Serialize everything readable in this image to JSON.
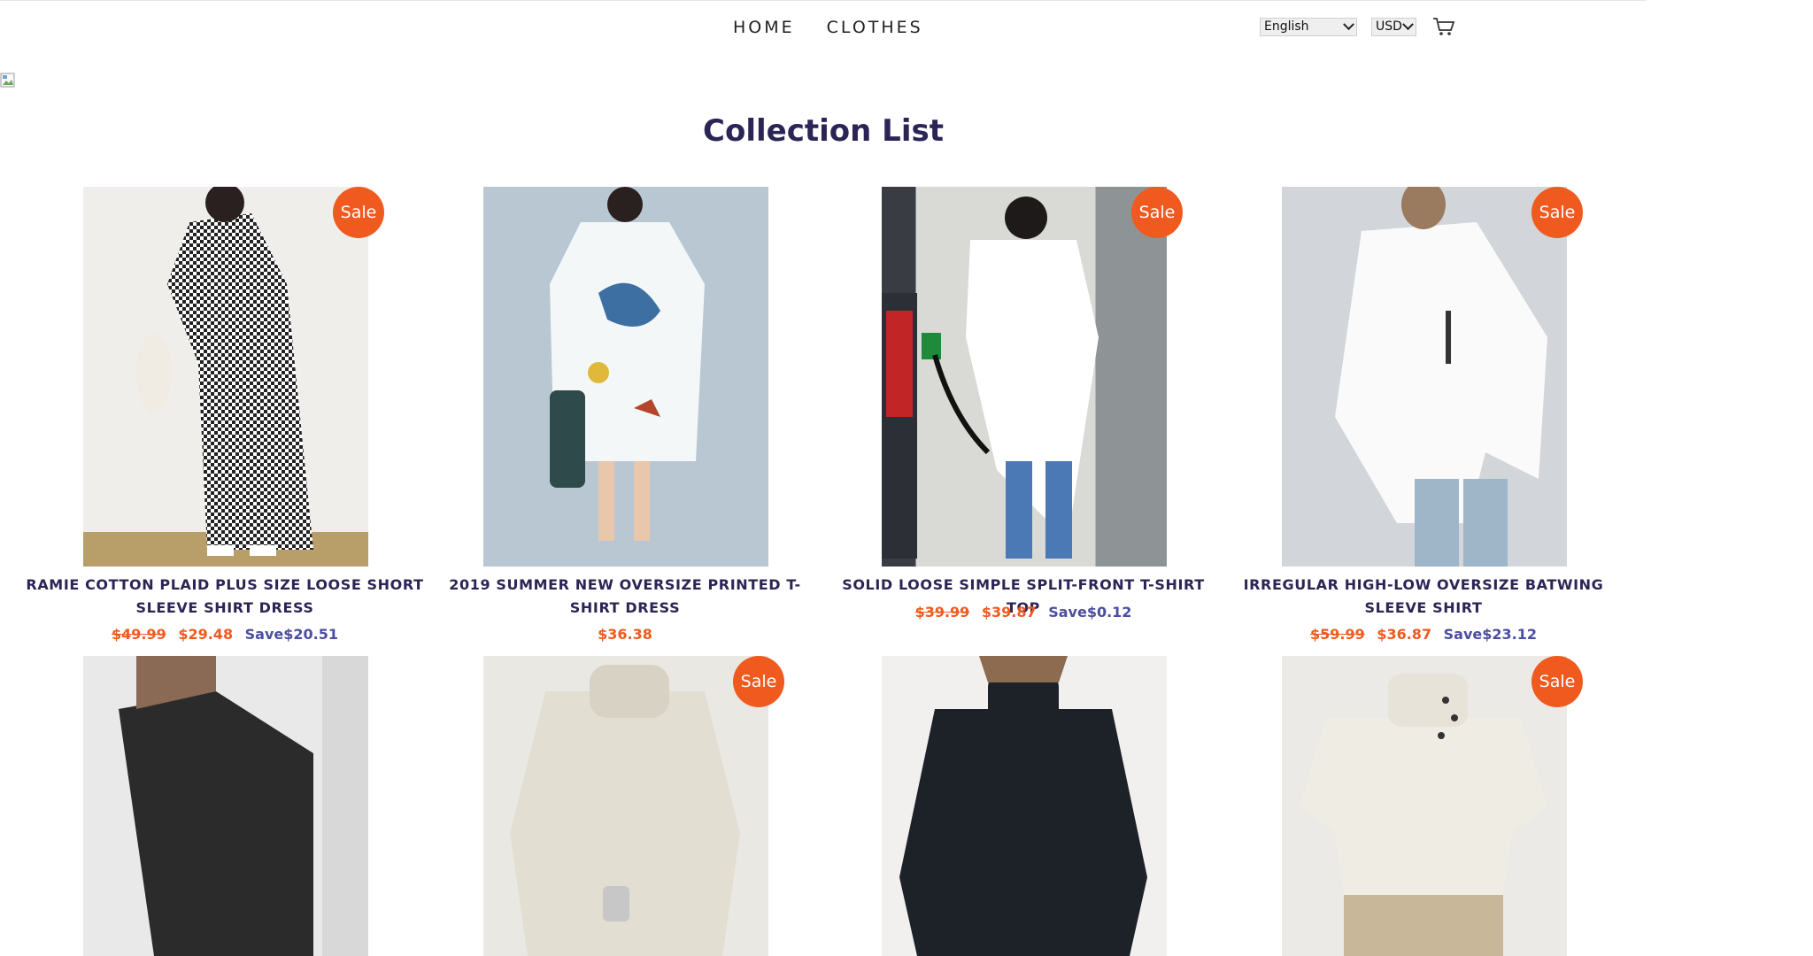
{
  "nav": {
    "items": [
      "HOME",
      "CLOTHES"
    ]
  },
  "controls": {
    "language": "English",
    "currency": "USD",
    "cart_icon": "cart-icon"
  },
  "page_title": "Collection List",
  "sale_badge": "Sale",
  "products": [
    {
      "title": "RAMIE COTTON PLAID PLUS SIZE LOOSE SHORT SLEEVE SHIRT DRESS",
      "old_price": "$49.99",
      "price": "$29.48",
      "save": "Save$20.51",
      "on_sale": true
    },
    {
      "title": "2019 SUMMER NEW OVERSIZE PRINTED T-SHIRT DRESS",
      "old_price": "",
      "price": "$36.38",
      "save": "",
      "on_sale": false
    },
    {
      "title": "SOLID LOOSE SIMPLE SPLIT-FRONT T-SHIRT TOP",
      "old_price": "$39.99",
      "price": "$39.87",
      "save": "Save$0.12",
      "on_sale": true
    },
    {
      "title": "IRREGULAR HIGH-LOW OVERSIZE BATWING SLEEVE SHIRT",
      "old_price": "$59.99",
      "price": "$36.87",
      "save": "Save$23.12",
      "on_sale": true
    },
    {
      "title": "",
      "old_price": "",
      "price": "",
      "save": "",
      "on_sale": false
    },
    {
      "title": "",
      "old_price": "",
      "price": "",
      "save": "",
      "on_sale": true
    },
    {
      "title": "",
      "old_price": "",
      "price": "",
      "save": "",
      "on_sale": false
    },
    {
      "title": "",
      "old_price": "",
      "price": "",
      "save": "",
      "on_sale": true
    }
  ],
  "colors": {
    "accent": "#f05a1e",
    "title": "#2b2555",
    "save": "#4b4ea0"
  }
}
